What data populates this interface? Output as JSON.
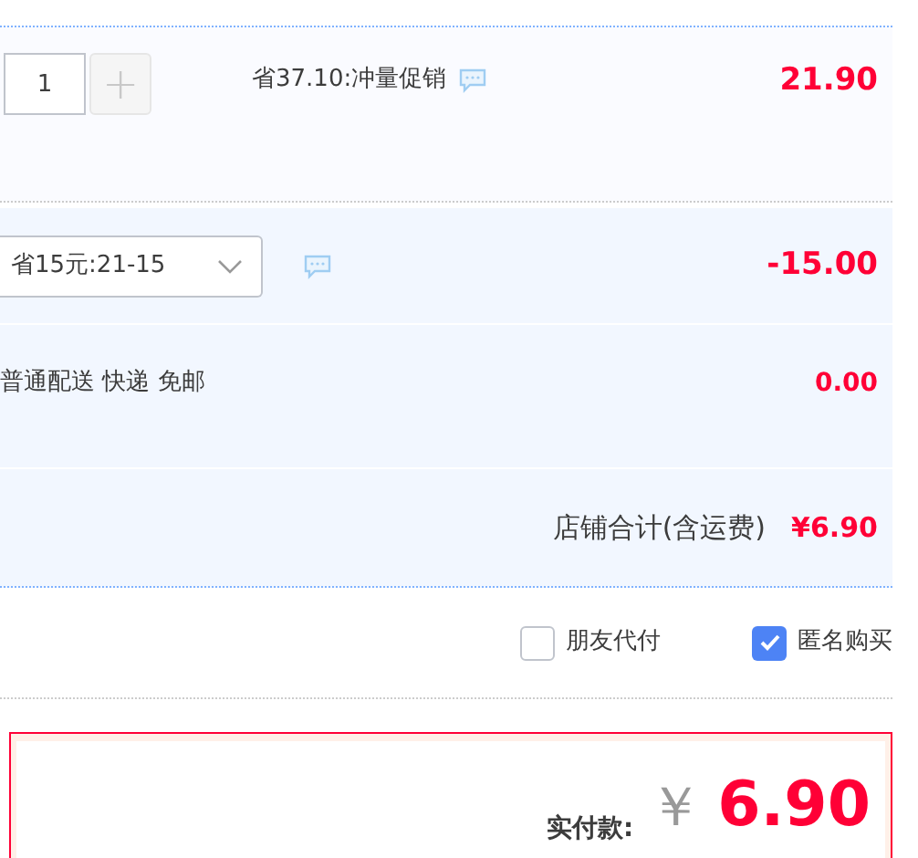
{
  "item": {
    "quantity": "1",
    "plus": "+",
    "promo": "省37.10:冲量促销",
    "price": "21.90"
  },
  "coupon": {
    "value": "省15元:21-15",
    "amount": "-15.00"
  },
  "shipping": {
    "label": "普通配送 快递 免邮",
    "amount": "0.00"
  },
  "store_total": {
    "label": "店铺合计(含运费)",
    "amount": "¥6.90"
  },
  "options": [
    {
      "label": "朋友代付",
      "checked": false
    },
    {
      "label": "匿名购买",
      "checked": true
    }
  ],
  "payment": {
    "label": "实付款:",
    "currency": "￥",
    "amount": "6.90"
  }
}
